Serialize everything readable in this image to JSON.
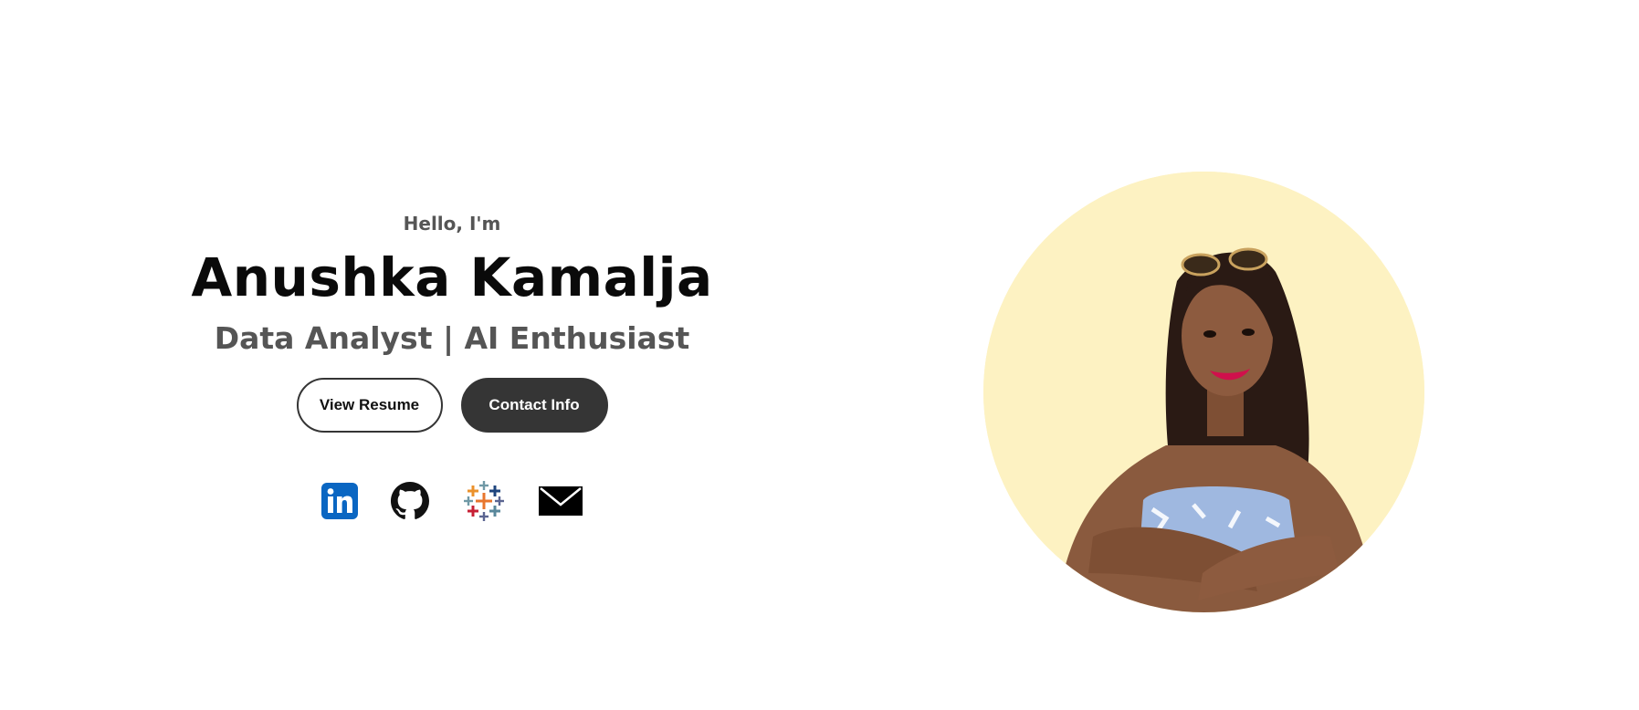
{
  "hero": {
    "greeting": "Hello, I'm",
    "name": "Anushka Kamalja",
    "role": "Data Analyst | AI Enthusiast"
  },
  "buttons": {
    "resume_label": "View Resume",
    "contact_label": "Contact Info"
  },
  "socials": [
    {
      "icon": "linkedin-icon",
      "color": "#0a66c2"
    },
    {
      "icon": "github-icon",
      "color": "#111111"
    },
    {
      "icon": "tableau-icon",
      "color": "#e8762d"
    },
    {
      "icon": "email-icon",
      "color": "#000000"
    }
  ],
  "portrait": {
    "background_color": "#fdf2c2",
    "alt": "profile photo"
  },
  "colors": {
    "text_dark": "#0a0a0a",
    "text_muted": "#555555",
    "button_dark": "#353535"
  }
}
